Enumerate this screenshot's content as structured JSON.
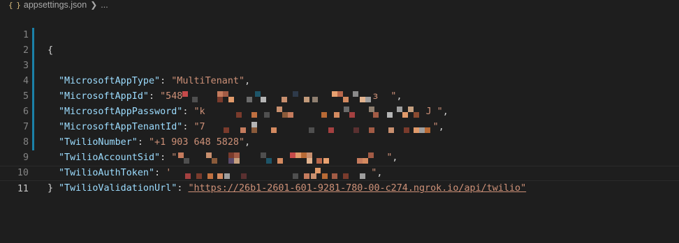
{
  "breadcrumb": {
    "file_icon": "{ }",
    "file_name": "appsettings.json",
    "separator_icon": "chevron-right-icon",
    "ellipsis": "..."
  },
  "editor": {
    "language": "json",
    "current_line": 11,
    "lines": [
      {
        "number": "1",
        "text": "{"
      },
      {
        "number": "2",
        "key": "\"MicrosoftAppType\"",
        "value": "\"MultiTenant\""
      },
      {
        "number": "3",
        "key": "\"MicrosoftAppId\"",
        "value_prefix": "\"548",
        "value_suffix": "\"",
        "redacted": true
      },
      {
        "number": "4",
        "key": "\"MicrosoftAppPassword\"",
        "value_prefix": "\"k",
        "value_suffix": "\"",
        "redacted": true
      },
      {
        "number": "5",
        "key": "\"MicrosoftAppTenantId\"",
        "value_prefix": "\"7",
        "value_suffix": "\"",
        "redacted": true
      },
      {
        "number": "6",
        "key": "\"TwilioNumber\"",
        "value": "\"+1 903 648 5828\""
      },
      {
        "number": "7",
        "key": "\"TwilioAccountSid\"",
        "value_prefix": "\"",
        "value_suffix": "\"",
        "redacted": true
      },
      {
        "number": "8",
        "key": "\"TwilioAuthToken\"",
        "value_prefix": "'",
        "value_suffix": "\"",
        "redacted": true
      },
      {
        "number": "9",
        "key": "\"TwilioValidationUrl\"",
        "value": "\"https://26b1-2601-601-9281-780-00-c274.ngrok.io/api/twilio\""
      },
      {
        "number": "10",
        "text": "}"
      },
      {
        "number": "11",
        "text": ""
      }
    ],
    "colon": ":",
    "comma": ","
  },
  "colors": {
    "background": "#1e1e1e",
    "key": "#9cdcfe",
    "string": "#ce9178",
    "gutter_modified": "#1b81a8",
    "line_number": "#858585"
  }
}
